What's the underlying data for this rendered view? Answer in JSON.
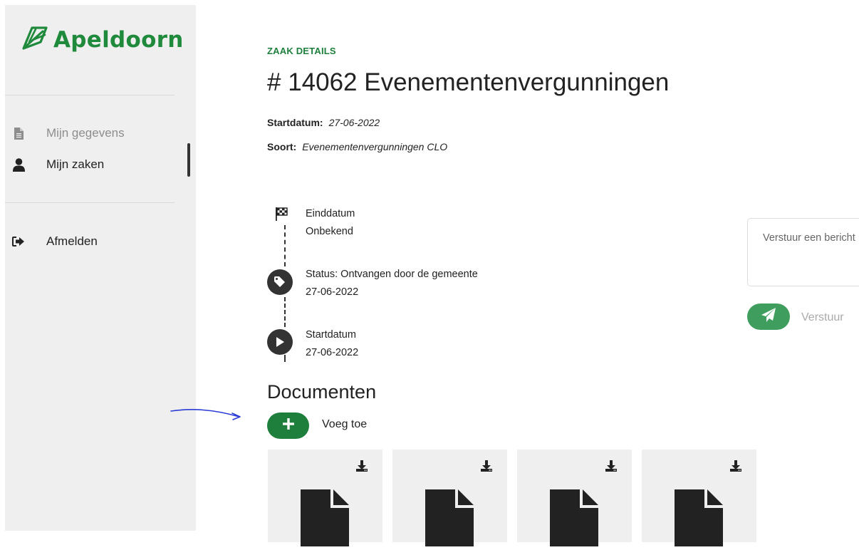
{
  "brand": {
    "name": "Apeldoorn",
    "color": "#1f8a3b",
    "logo_icon": "leaf-icon"
  },
  "sidebar": {
    "items": [
      {
        "label": "Mijn gegevens",
        "icon": "document-icon",
        "active": false
      },
      {
        "label": "Mijn zaken",
        "icon": "user-icon",
        "active": true
      },
      {
        "label": "Afmelden",
        "icon": "sign-out-icon",
        "active": false
      }
    ]
  },
  "case": {
    "kicker": "ZAAK DETAILS",
    "title": "# 14062 Evenementenvergunningen",
    "start_label": "Startdatum:",
    "start_value": "27-06-2022",
    "type_label": "Soort:",
    "type_value": "Evenementenvergunningen CLO"
  },
  "timeline": [
    {
      "icon": "checkered-flag-icon",
      "title": "Einddatum",
      "date": "Onbekend"
    },
    {
      "icon": "tag-icon",
      "title": "Status: Ontvangen door de gemeente",
      "date": "27-06-2022"
    },
    {
      "icon": "play-icon",
      "title": "Startdatum",
      "date": "27-06-2022"
    }
  ],
  "documents": {
    "heading": "Documenten",
    "add_label": "Voeg toe",
    "cards": [
      {
        "icon": "file-icon",
        "download_icon": "download-icon"
      },
      {
        "icon": "file-icon",
        "download_icon": "download-icon"
      },
      {
        "icon": "file-icon",
        "download_icon": "download-icon"
      },
      {
        "icon": "file-icon",
        "download_icon": "download-icon"
      }
    ]
  },
  "message": {
    "placeholder": "Verstuur een bericht",
    "send_label": "Verstuur",
    "send_icon": "paper-plane-icon"
  },
  "colors": {
    "accent": "#1e7f3c",
    "send_button": "#3f9e5d",
    "sidebar_bg": "#efefef",
    "annotation": "#2a3bd6"
  }
}
